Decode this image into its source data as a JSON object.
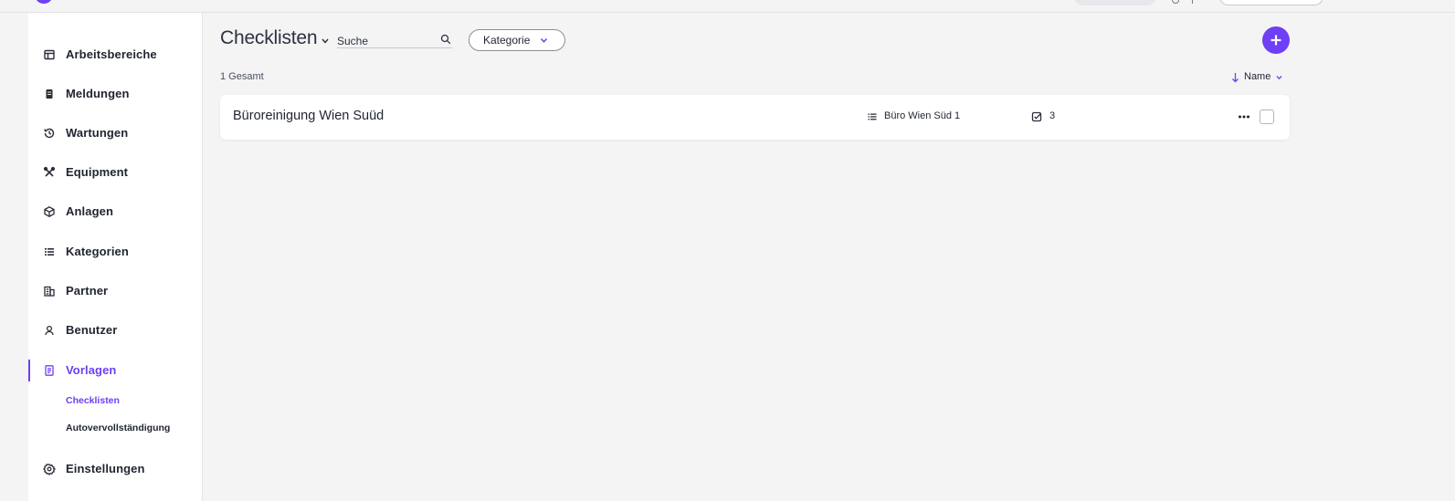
{
  "sidebar": {
    "items": [
      {
        "label": "Arbeitsbereiche",
        "icon": "layout-icon"
      },
      {
        "label": "Meldungen",
        "icon": "notification-icon"
      },
      {
        "label": "Wartungen",
        "icon": "history-icon"
      },
      {
        "label": "Equipment",
        "icon": "tools-icon"
      },
      {
        "label": "Anlagen",
        "icon": "cube-icon"
      },
      {
        "label": "Kategorien",
        "icon": "list-icon"
      },
      {
        "label": "Partner",
        "icon": "building-icon"
      },
      {
        "label": "Benutzer",
        "icon": "user-icon"
      },
      {
        "label": "Vorlagen",
        "icon": "document-icon"
      },
      {
        "label": "Einstellungen",
        "icon": "gear-icon"
      }
    ],
    "subitems": [
      {
        "label": "Checklisten"
      },
      {
        "label": "Autovervollständigung"
      }
    ]
  },
  "header": {
    "title": "Checklisten",
    "search_placeholder": "Suche",
    "filter_label": "Kategorie"
  },
  "list": {
    "count_label": "1 Gesamt",
    "sort_label": "Name",
    "rows": [
      {
        "name": "Büroreinigung Wien Suüd",
        "category": "Büro Wien Süd 1",
        "checks": "3"
      }
    ]
  },
  "colors": {
    "accent": "#6d3ff5",
    "background": "#f4f4f5"
  }
}
